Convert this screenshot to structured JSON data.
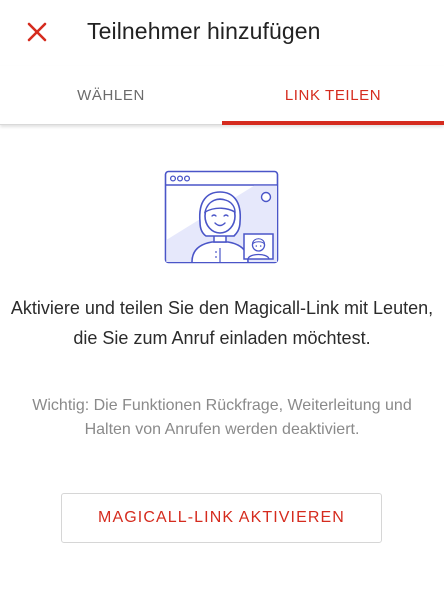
{
  "header": {
    "title": "Teilnehmer hinzufügen",
    "close_icon": "close-icon"
  },
  "tabs": [
    {
      "label": "WÄHLEN",
      "active": false
    },
    {
      "label": "LINK TEILEN",
      "active": true
    }
  ],
  "content": {
    "illustration_icon": "video-call-illustration",
    "main_text": "Aktiviere und teilen Sie den Magicall-Link mit Leuten, die Sie zum Anruf einladen möchtest.",
    "sub_text": "Wichtig: Die Funktionen Rückfrage, Weiterleitung und Halten von Anrufen werden deaktiviert.",
    "button_label": "MAGICALL-LINK AKTIVIEREN"
  },
  "colors": {
    "accent": "#d52b1e",
    "illustration": "#4a55c8",
    "illustration_fill": "#e6e8fb"
  }
}
